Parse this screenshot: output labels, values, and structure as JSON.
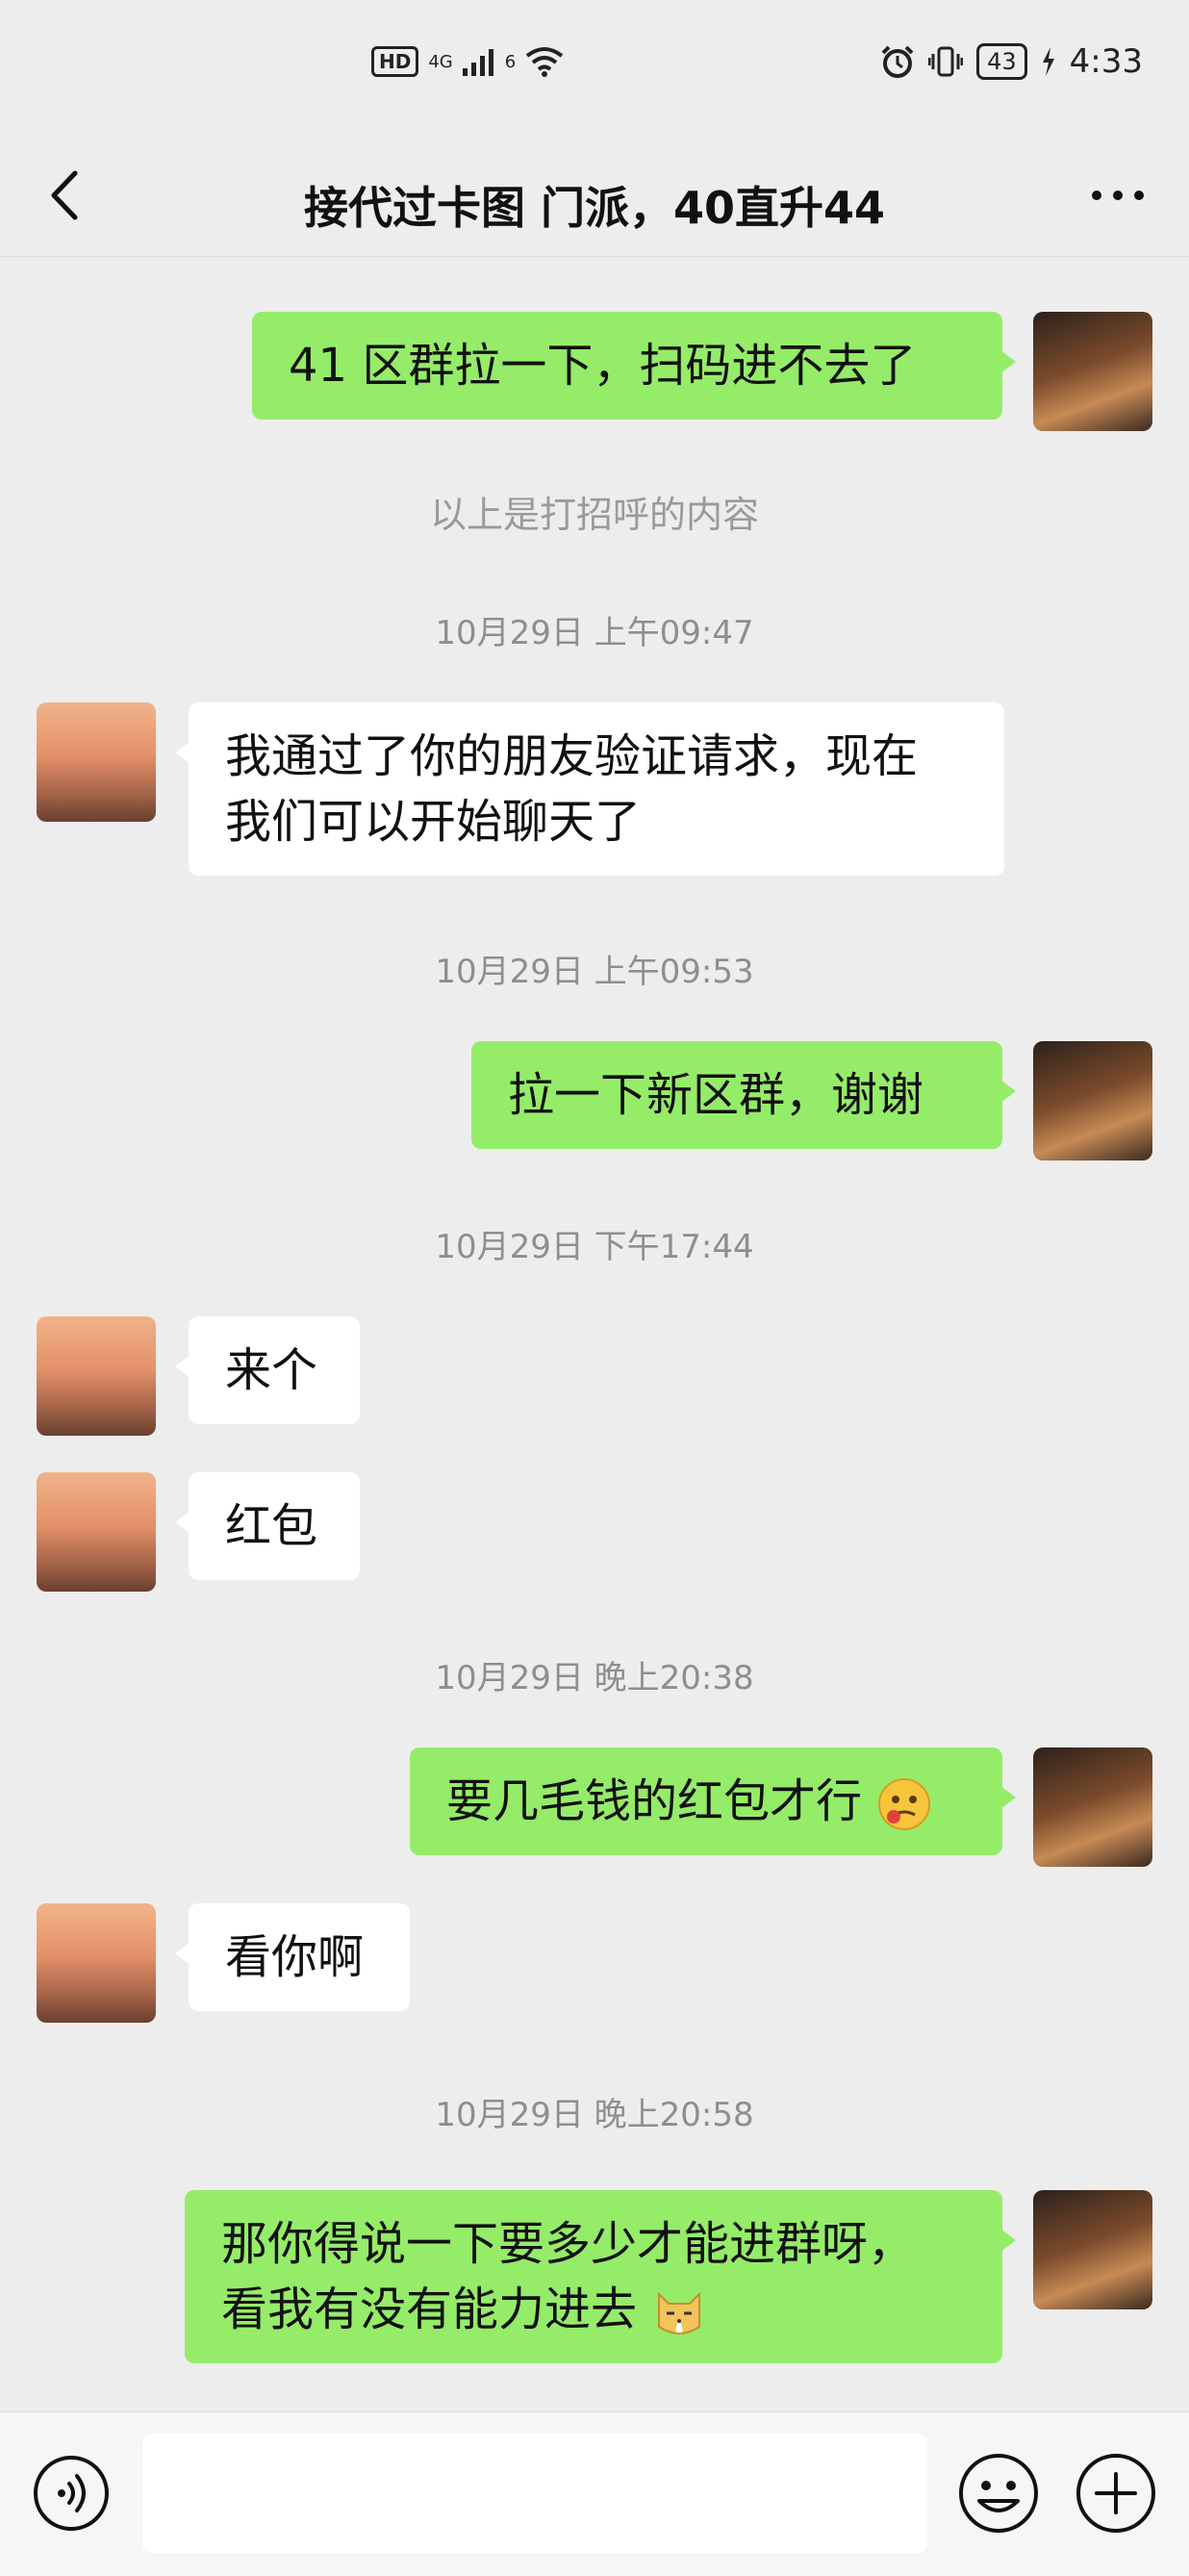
{
  "status_bar": {
    "hd": "HD",
    "net1": "4G",
    "net2": "6",
    "battery": "43",
    "time": "4:33"
  },
  "header": {
    "title": "接代过卡图 门派，40直升44"
  },
  "messages": {
    "m1": "41 区群拉一下，扫码进不去了",
    "sys": "以上是打招呼的内容",
    "ts1": "10月29日 上午09:47",
    "m2_line1": "我通过了你的朋友验证请求，现在",
    "m2_line2": "我们可以开始聊天了",
    "ts2": "10月29日 上午09:53",
    "m3": "拉一下新区群，谢谢",
    "ts3": "10月29日 下午17:44",
    "m4": "来个",
    "m5": "红包",
    "ts4": "10月29日 晚上20:38",
    "m6": "要几毛钱的红包才行",
    "m7": "看你啊",
    "ts5": "10月29日 晚上20:58",
    "m8_line1": "那你得说一下要多少才能进群呀，",
    "m8_line2": "看我有没有能力进去"
  },
  "input": {
    "value": "",
    "placeholder": ""
  },
  "icons": {
    "back": "back-chevron-icon",
    "more": "more-dots-icon",
    "voice": "voice-icon",
    "emoji": "emoji-icon",
    "plus": "plus-icon"
  },
  "colors": {
    "bg": "#ededed",
    "outgoing_bubble": "#95ec69",
    "incoming_bubble": "#ffffff",
    "timestamp": "#8e8e8e"
  }
}
